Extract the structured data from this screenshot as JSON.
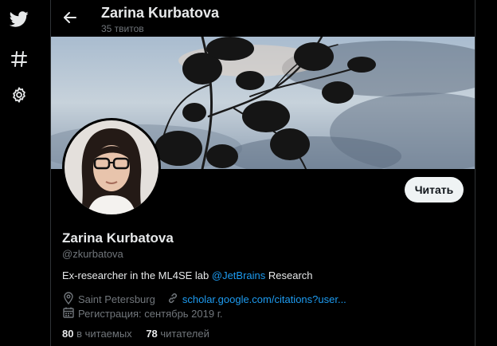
{
  "header": {
    "title": "Zarina Kurbatova",
    "tweets_count": "35 твитов"
  },
  "profile": {
    "follow_label": "Читать",
    "display_name": "Zarina Kurbatova",
    "handle": "@zkurbatova",
    "bio_pre": "Ex-researcher in the ML4SE lab ",
    "bio_mention": "@JetBrains",
    "bio_post": " Research",
    "location": "Saint Petersburg",
    "website": "scholar.google.com/citations?user...",
    "joined": "Регистрация: сентябрь 2019 г.",
    "following_count": "80",
    "following_label": " в читаемых",
    "followers_count": "78",
    "followers_label": " читателей"
  },
  "colors": {
    "background": "#000000",
    "accent": "#1d9bf0",
    "muted": "#71767b",
    "button_bg": "#eff3f4"
  },
  "icons": [
    "twitter-logo",
    "hashtag-icon",
    "gear-icon",
    "back-arrow-icon",
    "location-icon",
    "link-icon",
    "calendar-icon"
  ]
}
